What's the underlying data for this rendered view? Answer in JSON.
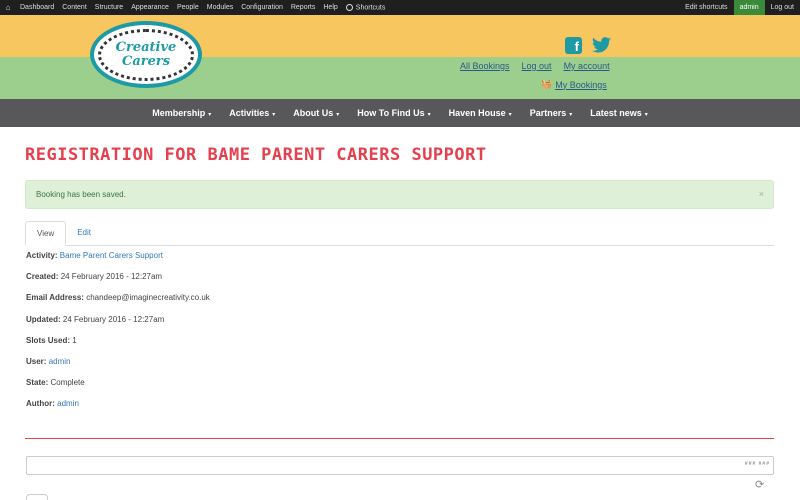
{
  "admin_bar": {
    "home_icon": "home-icon",
    "items": [
      "Dashboard",
      "Content",
      "Structure",
      "Appearance",
      "People",
      "Modules",
      "Configuration",
      "Reports",
      "Help"
    ],
    "shortcuts": "Shortcuts",
    "edit_shortcuts": "Edit shortcuts",
    "user": "admin",
    "logout": "Log out"
  },
  "header": {
    "logo_line1": "Creative",
    "logo_line2": "Carers",
    "links": [
      "All Bookings",
      "Log out",
      "My account"
    ],
    "my_bookings": "My Bookings",
    "colors": {
      "top": "#f7c65e",
      "bottom": "#9ccf8d",
      "brand": "#1e9aa5"
    }
  },
  "nav": {
    "items": [
      "Membership",
      "Activities",
      "About Us",
      "How To Find Us",
      "Haven House",
      "Partners",
      "Latest news"
    ],
    "caret": "▾"
  },
  "page": {
    "title": "REGISTRATION FOR BAME PARENT CARERS SUPPORT",
    "alert": "Booking has been saved.",
    "alert_close": "×",
    "tabs": [
      "View",
      "Edit"
    ],
    "fields": {
      "activity_label": "Activity:",
      "activity_value": "Bame Parent Carers Support",
      "created_label": "Created:",
      "created_value": "24 February 2016 - 12:27am",
      "email_label": "Email Address:",
      "email_value": "chandeep@imaginecreativity.co.uk",
      "updated_label": "Updated:",
      "updated_value": "24 February 2016 - 12:27am",
      "slots_label": "Slots Used:",
      "slots_value": "1",
      "user_label": "User:",
      "user_value": "admin",
      "state_label": "State:",
      "state_value": "Complete",
      "author_label": "Author:",
      "author_value": "admin"
    },
    "editor_tools": "### ###"
  }
}
